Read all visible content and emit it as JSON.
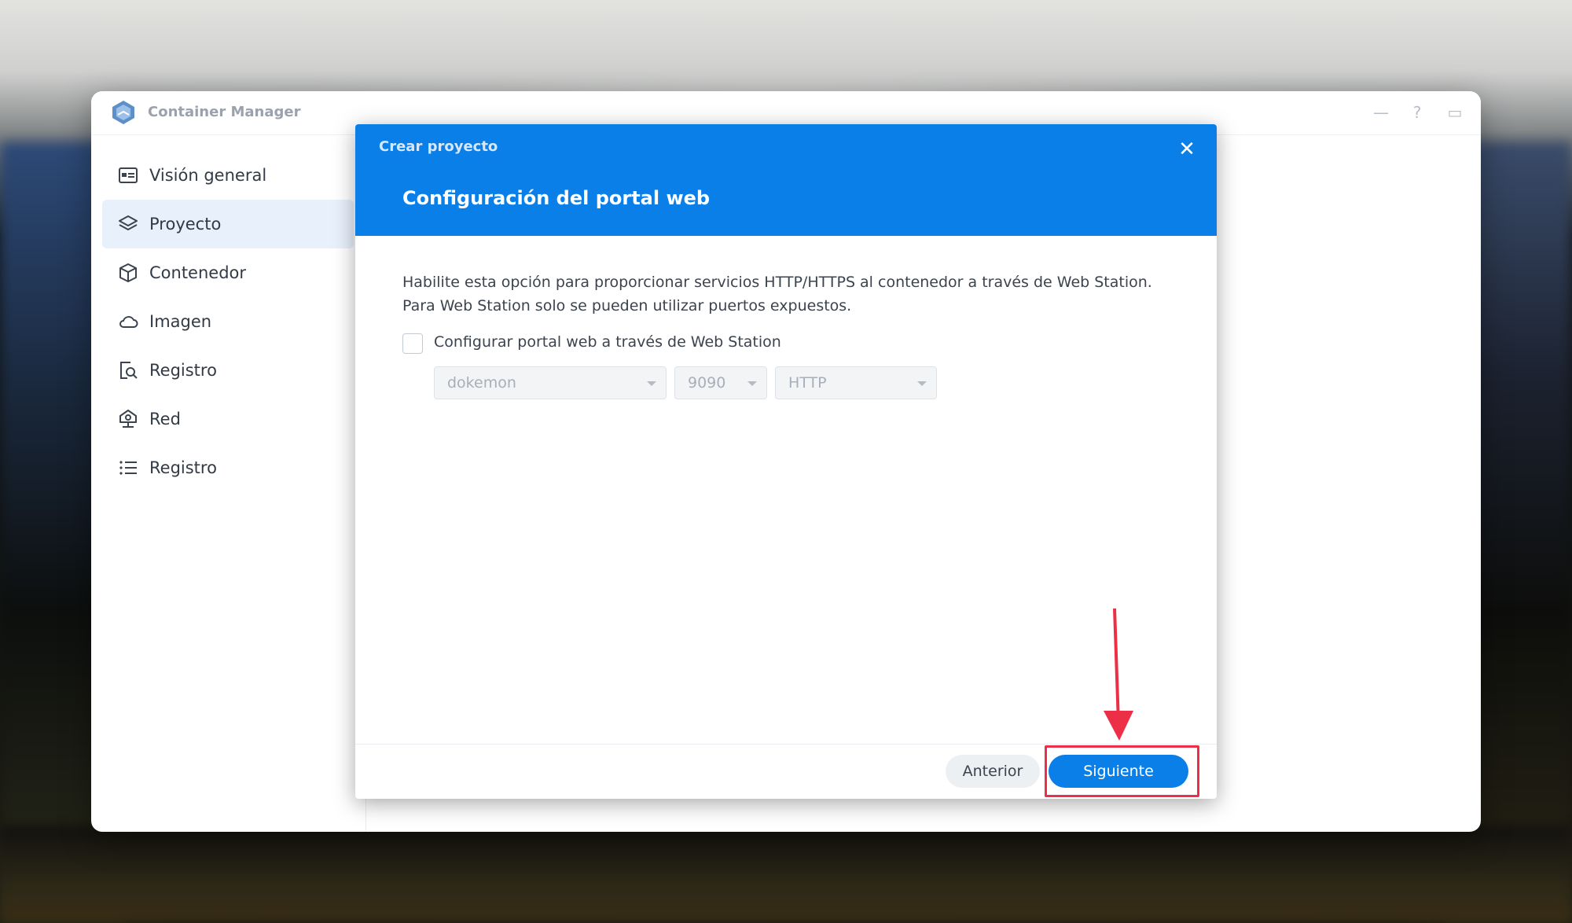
{
  "app": {
    "title": "Container Manager",
    "window_controls": [
      "?",
      "—",
      "▭",
      "✕"
    ]
  },
  "sidebar": {
    "items": [
      {
        "label": "Visión general",
        "icon": "overview-icon",
        "active": false
      },
      {
        "label": "Proyecto",
        "icon": "layers-icon",
        "active": true
      },
      {
        "label": "Contenedor",
        "icon": "box-icon",
        "active": false
      },
      {
        "label": "Imagen",
        "icon": "cloud-icon",
        "active": false
      },
      {
        "label": "Registro",
        "icon": "registry-search-icon",
        "active": false
      },
      {
        "label": "Red",
        "icon": "network-icon",
        "active": false
      },
      {
        "label": "Registro",
        "icon": "list-icon",
        "active": false
      }
    ]
  },
  "dialog": {
    "subtitle": "Crear proyecto",
    "title": "Configuración del portal web",
    "close_glyph": "✕",
    "description_line1": "Habilite esta opción para proporcionar servicios HTTP/HTTPS al contenedor a través de Web Station.",
    "description_line2": "Para Web Station solo se pueden utilizar puertos expuestos.",
    "checkbox": {
      "label": "Configurar portal web a través de Web Station",
      "checked": false
    },
    "selects": {
      "service": "dokemon",
      "port": "9090",
      "protocol": "HTTP"
    },
    "buttons": {
      "previous": "Anterior",
      "next": "Siguiente"
    }
  },
  "colors": {
    "accent": "#0a7fe8",
    "annotation": "#ec2f46",
    "sidebar_active": "#e8f0fc"
  }
}
